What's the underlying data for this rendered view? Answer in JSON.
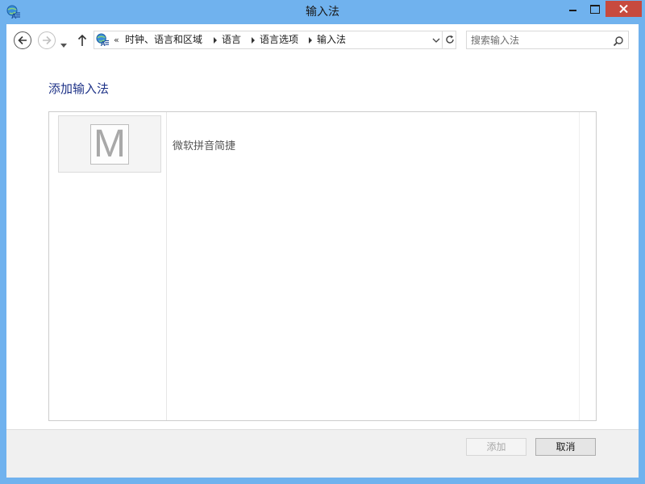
{
  "window": {
    "title": "输入法",
    "colors": {
      "frame": "#70b2ee",
      "close": "#c74a3e",
      "title_link": "#1e3287"
    }
  },
  "icons": {
    "app": "language-globe-icon",
    "back": "back-arrow-icon",
    "forward": "forward-arrow-icon",
    "recent": "chevron-down-icon",
    "up": "up-arrow-icon",
    "refresh": "refresh-icon",
    "search": "search-icon"
  },
  "address": {
    "overflow": "«",
    "crumbs": [
      "时钟、语言和区域",
      "语言",
      "语言选项",
      "输入法"
    ]
  },
  "search": {
    "placeholder": "搜索输入法"
  },
  "main": {
    "heading": "添加输入法",
    "items": [
      {
        "logo_letter": "M",
        "name": "微软拼音简捷"
      }
    ]
  },
  "footer": {
    "add_label": "添加",
    "cancel_label": "取消"
  }
}
